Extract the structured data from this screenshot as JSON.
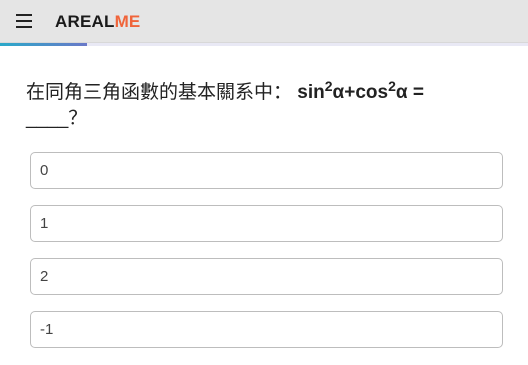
{
  "header": {
    "menu_icon": "hamburger-menu-icon",
    "logo_part1": "AREAL",
    "logo_part2": "ME",
    "logo_part2_color": "#f0643a"
  },
  "progress": {
    "fraction": 0.165
  },
  "question": {
    "text_cn": "在同角三角函數的基本關系中：",
    "f1": "sin",
    "sup1": "2",
    "f2": "α+cos",
    "sup2": "2",
    "f3": "α =",
    "blank": "____",
    "tail": "？"
  },
  "options": [
    {
      "label": "0"
    },
    {
      "label": "1"
    },
    {
      "label": "2"
    },
    {
      "label": "-1"
    }
  ]
}
